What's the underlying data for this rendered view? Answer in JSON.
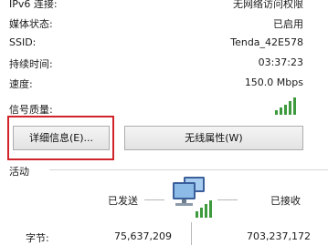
{
  "connection": {
    "rows": [
      {
        "label": "IPv6 连接:",
        "value": "无网络访问权限"
      },
      {
        "label": "媒体状态:",
        "value": "已启用"
      },
      {
        "label": "SSID:",
        "value": "Tenda_42E578"
      },
      {
        "label": "持续时间:",
        "value": "03:37:23"
      },
      {
        "label": "速度:",
        "value": "150.0 Mbps"
      }
    ],
    "signal_label": "信号质量:",
    "signal_bars": 5,
    "signal_icon": "signal-bars-icon"
  },
  "buttons": {
    "details": "详细信息(E)...",
    "wireless_properties": "无线属性(W)"
  },
  "activity": {
    "group_title": "活动",
    "sent_label": "已发送",
    "received_label": "已接收",
    "bytes_label": "字节:",
    "bytes_sent": "75,637,209",
    "bytes_received": "703,237,172",
    "icon": "network-computer-icon"
  },
  "colors": {
    "highlight": "#d0232a",
    "signal": "#3d9a3d"
  }
}
